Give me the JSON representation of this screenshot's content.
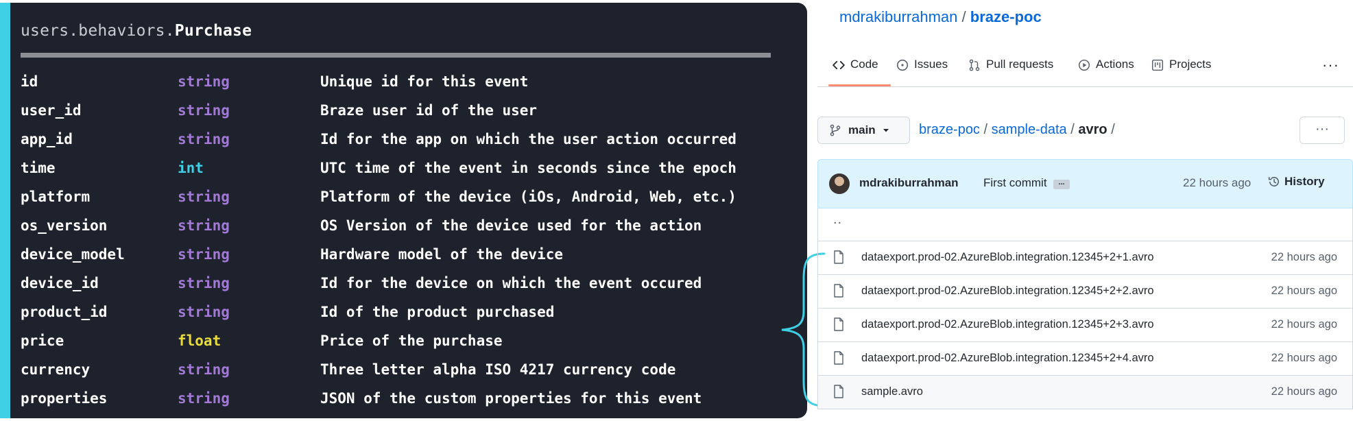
{
  "schema": {
    "title_prefix": "users.behaviors.",
    "title_name": "Purchase",
    "fields": [
      {
        "name": "id",
        "type": "string",
        "desc": "Unique id for this event"
      },
      {
        "name": "user_id",
        "type": "string",
        "desc": "Braze user id of the user"
      },
      {
        "name": "app_id",
        "type": "string",
        "desc": "Id for the app on which the user action occurred"
      },
      {
        "name": "time",
        "type": "int",
        "desc": "UTC time of the event in seconds since the epoch"
      },
      {
        "name": "platform",
        "type": "string",
        "desc": "Platform of the device (iOs, Android, Web, etc.)"
      },
      {
        "name": "os_version",
        "type": "string",
        "desc": "OS Version of the device used for the action"
      },
      {
        "name": "device_model",
        "type": "string",
        "desc": "Hardware model of the device"
      },
      {
        "name": "device_id",
        "type": "string",
        "desc": "Id for the device on which the event occured"
      },
      {
        "name": "product_id",
        "type": "string",
        "desc": "Id of the product purchased"
      },
      {
        "name": "price",
        "type": "float",
        "desc": "Price of the purchase"
      },
      {
        "name": "currency",
        "type": "string",
        "desc": "Three letter alpha ISO 4217 currency code"
      },
      {
        "name": "properties",
        "type": "string",
        "desc": "JSON of the custom properties for this event"
      }
    ]
  },
  "github": {
    "owner": "mdrakiburrahman",
    "separator": "/",
    "repo": "braze-poc",
    "tabs": [
      {
        "label": "Code",
        "icon": "code-icon"
      },
      {
        "label": "Issues",
        "icon": "issue-icon"
      },
      {
        "label": "Pull requests",
        "icon": "pull-request-icon"
      },
      {
        "label": "Actions",
        "icon": "play-icon"
      },
      {
        "label": "Projects",
        "icon": "project-icon"
      }
    ],
    "more_label": "···",
    "branch": "main",
    "breadcrumb": {
      "root": "braze-poc",
      "dir1": "sample-data",
      "current": "avro",
      "sep": "/"
    },
    "dots_label": "···",
    "commit": {
      "author": "mdrakiburrahman",
      "message": "First commit",
      "ellipsis": "...",
      "age": "22 hours ago",
      "history_label": "History"
    },
    "up_dir": "..",
    "files": [
      {
        "name": "dataexport.prod-02.AzureBlob.integration.12345+2+1.avro",
        "age": "22 hours ago"
      },
      {
        "name": "dataexport.prod-02.AzureBlob.integration.12345+2+2.avro",
        "age": "22 hours ago"
      },
      {
        "name": "dataexport.prod-02.AzureBlob.integration.12345+2+3.avro",
        "age": "22 hours ago"
      },
      {
        "name": "dataexport.prod-02.AzureBlob.integration.12345+2+4.avro",
        "age": "22 hours ago"
      },
      {
        "name": "sample.avro",
        "age": "22 hours ago"
      }
    ]
  },
  "colors": {
    "panel_bg": "#1e222c",
    "accent_bar": "#3fd0e6",
    "type_string": "#a27ad6",
    "type_int": "#3fd0e6",
    "type_float": "#e7dc3b",
    "brace": "#3fd0e6",
    "link": "#0969da",
    "active_tab_underline": "#fd8c73",
    "commit_bg": "#ddf4ff"
  }
}
